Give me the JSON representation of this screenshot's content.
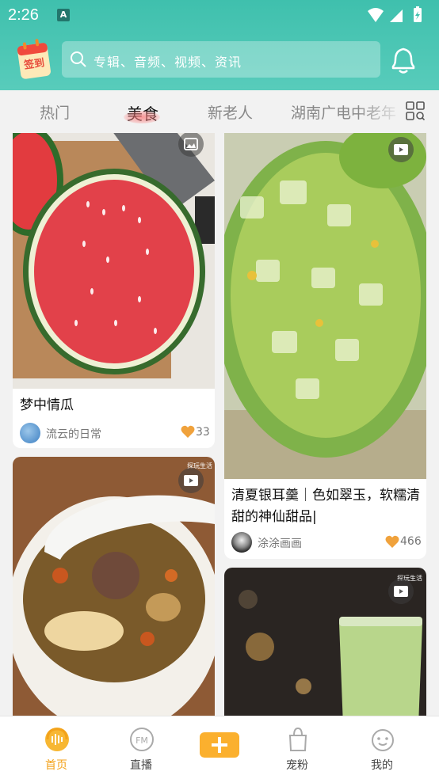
{
  "status_bar": {
    "time": "2:26",
    "notif_letter": "A"
  },
  "header": {
    "sign_label": "签到",
    "search_placeholder": "专辑、音频、视频、资讯"
  },
  "tabs": [
    {
      "label": "热门"
    },
    {
      "label": "美食"
    },
    {
      "label": "新老人"
    },
    {
      "label": "湖南广电中老年"
    }
  ],
  "active_tab": "美食",
  "cards": [
    {
      "title": "梦中情瓜",
      "author": "流云的日常",
      "likes": "33",
      "media": "image"
    },
    {
      "title": "清夏银耳羹｜色如翠玉，软糯清甜的神仙甜品|",
      "author": "涂涂画画",
      "likes": "466",
      "media": "video"
    },
    {
      "title": "",
      "author": "",
      "likes": "",
      "media": "video",
      "watermark": "探玩生活"
    },
    {
      "title": "",
      "author": "",
      "likes": "",
      "media": "video",
      "watermark": "探玩生活"
    }
  ],
  "bottom_nav": [
    {
      "label": "首页",
      "icon": "home-audio-icon",
      "active": true
    },
    {
      "label": "直播",
      "icon": "fm-radio-icon"
    },
    {
      "label": "",
      "icon": "plus-icon"
    },
    {
      "label": "宠粉",
      "icon": "shopping-bag-icon"
    },
    {
      "label": "我的",
      "icon": "smiley-face-icon"
    }
  ],
  "colors": {
    "header": "#3fc0ad",
    "accent": "#f3a21b",
    "like": "#f0a23c",
    "plus": "#fbb02e"
  }
}
